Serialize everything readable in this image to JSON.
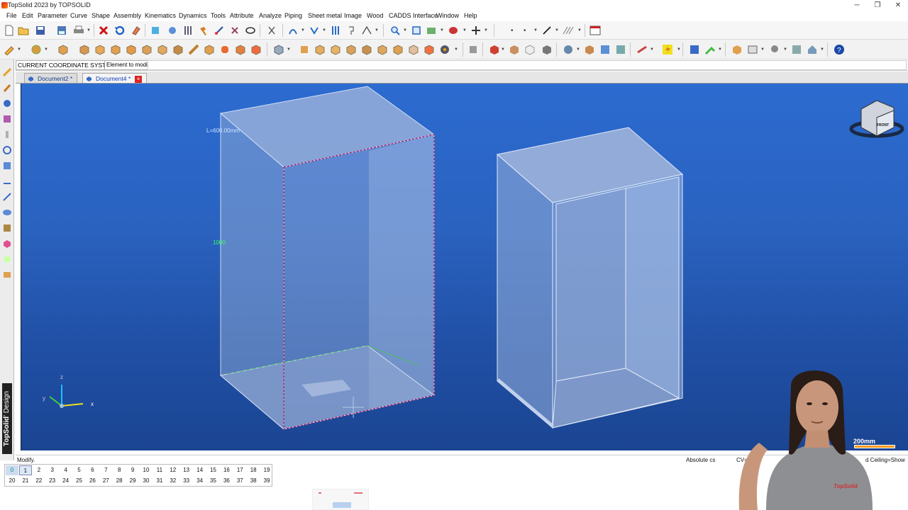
{
  "window": {
    "title": "TopSolid 2023 by TOPSOLID"
  },
  "menu": [
    "File",
    "Edit",
    "Parameter",
    "Curve",
    "Shape",
    "Assembly",
    "Kinematics",
    "Dynamics",
    "Tools",
    "Attribute",
    "Analyze",
    "Piping",
    "Sheet metal",
    "Image",
    "Wood",
    "CADDS Interface",
    "Window",
    "Help"
  ],
  "toolbar": {
    "coordinate_system": "CURRENT COORDINATE SYSTEM",
    "element_label": "Element to modify:",
    "element_value": ""
  },
  "tabs": [
    {
      "label": "Document2 *",
      "active": false
    },
    {
      "label": "Document4 *",
      "active": true
    }
  ],
  "viewport": {
    "annotation_length": "L=600.00mm",
    "annotation_height": "1000",
    "axis_x": "x",
    "axis_y": "y",
    "axis_z": "z",
    "scale_label": "200mm",
    "view_cube_face": "FRONT",
    "background_color": "#2a62bf"
  },
  "sidebar": {
    "brand": "TopSolid",
    "brand_suffix": "' Design"
  },
  "status": {
    "mode": "Modify.",
    "cs": "Absolute cs",
    "cv": "CV=Off",
    "ceiling": "d  Ceiling=Show"
  },
  "layers": {
    "row1": [
      "0",
      "1",
      "2",
      "3",
      "4",
      "5",
      "6",
      "7",
      "8",
      "9",
      "10",
      "11",
      "12",
      "13",
      "14",
      "15",
      "16",
      "17",
      "18",
      "19"
    ],
    "row2": [
      "20",
      "21",
      "22",
      "23",
      "24",
      "25",
      "26",
      "27",
      "28",
      "29",
      "30",
      "31",
      "32",
      "33",
      "34",
      "35",
      "36",
      "37",
      "38",
      "39"
    ],
    "current": "1"
  },
  "presenter_brand": "TopSolid"
}
